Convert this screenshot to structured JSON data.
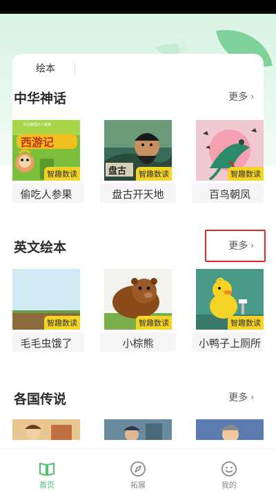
{
  "tabs": {
    "current": "绘本"
  },
  "sections": [
    {
      "title": "中华神话",
      "more_label": "更多",
      "books": [
        {
          "title": "偷吃人参果",
          "badge": "智趣数读",
          "cover_text": "西游记",
          "cover_subtext": "石汪寂强大人版第"
        },
        {
          "title": "盘古开天地",
          "badge": "智趣数读",
          "cover_text": "盘古"
        },
        {
          "title": "百鸟朝凤",
          "badge": "智趣数读"
        }
      ]
    },
    {
      "title": "英文绘本",
      "more_label": "更多",
      "books": [
        {
          "title": "毛毛虫饿了",
          "badge": "智趣数读"
        },
        {
          "title": "小棕熊",
          "badge": "智趣数读"
        },
        {
          "title": "小鸭子上厕所",
          "badge": "智趣数读"
        }
      ]
    },
    {
      "title": "各国传说",
      "more_label": "更多",
      "books": [
        {
          "title": ""
        },
        {
          "title": ""
        },
        {
          "title": ""
        }
      ]
    }
  ],
  "bottom_nav": {
    "items": [
      {
        "label": "首页",
        "icon": "book-open-icon",
        "active": true
      },
      {
        "label": "拓展",
        "icon": "compass-icon",
        "active": false
      },
      {
        "label": "我的",
        "icon": "smiley-face-icon",
        "active": false
      }
    ]
  },
  "colors": {
    "accent_green": "#4cc46e",
    "badge_yellow": "#f5d426",
    "highlight_red": "#e0262a"
  }
}
